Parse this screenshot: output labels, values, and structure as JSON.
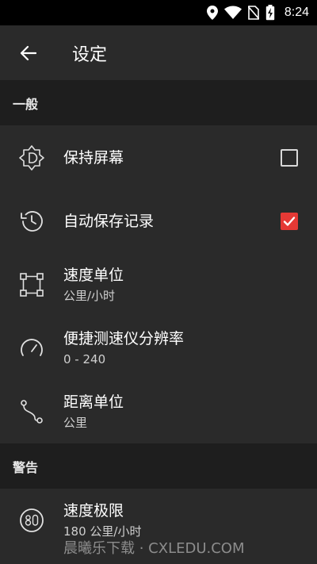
{
  "status_bar": {
    "time": "8:24"
  },
  "toolbar": {
    "title": "设定"
  },
  "sections": {
    "general": "一般",
    "warning": "警告"
  },
  "items": {
    "keep_screen": {
      "label": "保持屏幕",
      "checked": false
    },
    "auto_save": {
      "label": "自动保存记录",
      "checked": true
    },
    "speed_unit": {
      "label": "速度单位",
      "value": "公里/小时"
    },
    "speedometer_resolution": {
      "label": "便捷测速仪分辨率",
      "value": "0 - 240"
    },
    "distance_unit": {
      "label": "距离单位",
      "value": "公里"
    },
    "speed_limit": {
      "label": "速度极限",
      "value": "180 公里/小时"
    }
  },
  "watermark": "晨曦乐下载 · CXLEDU.COM",
  "colors": {
    "accent": "#e53935",
    "background": "#2a2a2a",
    "section_bg": "#1e1e1e"
  }
}
